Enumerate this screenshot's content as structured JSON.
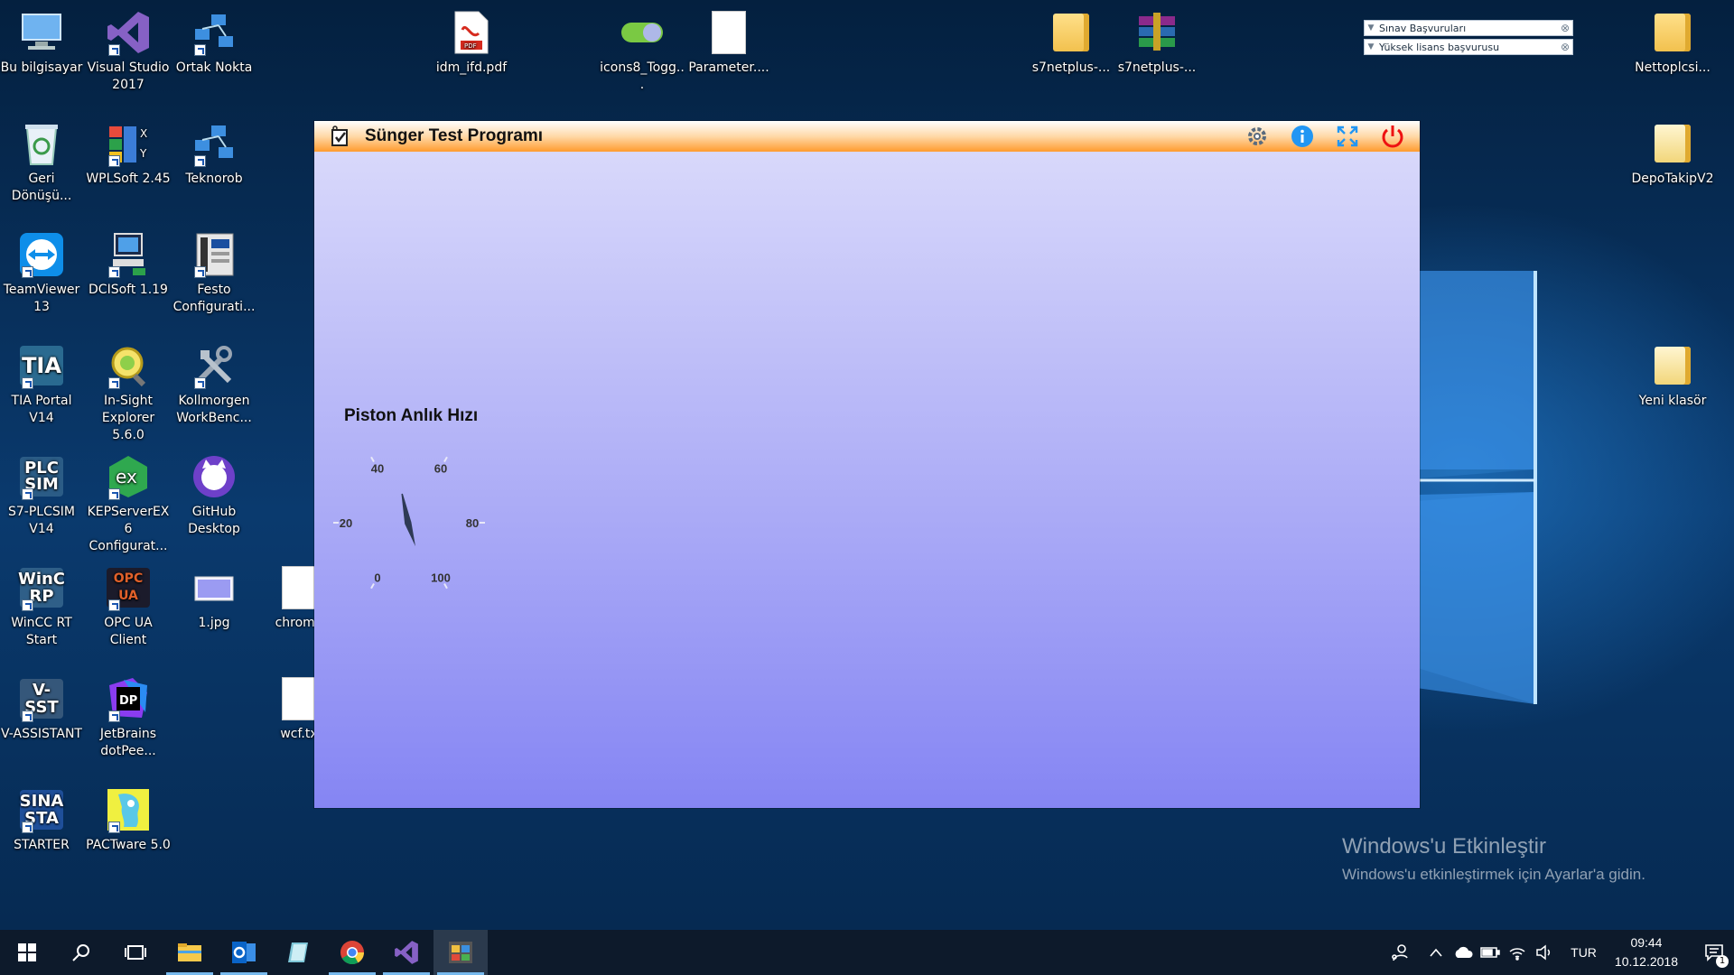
{
  "desktop": {
    "icons": {
      "bu_bilgisayar": "Bu bilgisayar",
      "visual_studio": "Visual Studio 2017",
      "ortak_nokta": "Ortak Nokta",
      "idm_pdf": "idm_ifd.pdf",
      "pdf_badge": "PDF",
      "icons8_toggle": "icons8_Togg...",
      "parameter": "Parameter....",
      "s7netplus_1": "s7netplus-...",
      "s7netplus_2": "s7netplus-...",
      "nettoplcsi": "Nettoplcsi...",
      "geri_donusum": "Geri Dönüşü...",
      "wplsoft": "WPLSoft 2.45",
      "teknorob": "Teknorob",
      "depotakip": "DepoTakipV2",
      "teamviewer": "TeamViewer 13",
      "dcisoft": "DCISoft 1.19",
      "festo": "Festo Configurati...",
      "tia_portal": "TIA Portal V14",
      "tia_text": "TIA",
      "insight": "In-Sight Explorer 5.6.0",
      "kollmorgen": "Kollmorgen WorkBenc...",
      "yeni_klasor": "Yeni klasör",
      "plcsim": "S7-PLCSIM V14",
      "plcsim_text": "PLC SIM",
      "kepserver": "KEPServerEX 6 Configurat...",
      "kepserver_text": "ex",
      "github": "GitHub Desktop",
      "wincc": "WinCC RT Start",
      "wincc_text": "WinC RP",
      "opcua": "OPC UA Client",
      "opcua_text": "OPC UA",
      "jpg": "1.jpg",
      "chrome_file": "chrome",
      "vassistant": "V-ASSISTANT",
      "vassistant_text": "V- SST",
      "jetbrains": "JetBrains dotPee...",
      "jetbrains_text": "DP",
      "wcf": "wcf.tx",
      "starter": "STARTER",
      "starter_text": "SINA STA",
      "pactware": "PACTware 5.0"
    },
    "sticky_tabs": [
      "Sınav Başvuruları",
      "Yüksek lisans başvurusu"
    ]
  },
  "app": {
    "title": "Sünger Test Programı",
    "buttons": [
      "settings",
      "info",
      "fullscreen",
      "power"
    ],
    "gauge": {
      "title": "Piston Anlık Hızı",
      "ticks": [
        "0",
        "20",
        "40",
        "60",
        "80",
        "100"
      ],
      "min": 0,
      "max": 100,
      "value": 45
    }
  },
  "watermark": {
    "line1": "Windows'u Etkinleştir",
    "line2": "Windows'u etkinleştirmek için Ayarlar'a gidin."
  },
  "taskbar": {
    "language": "TUR",
    "time": "09:44",
    "date": "10.12.2018",
    "notification_count": "1"
  },
  "colors": {
    "titlebar_accent": "#ff9b2e",
    "app_bg_top": "#dcdcfb",
    "app_bg_bottom": "#8585f3",
    "taskbar": "#0d1a2b"
  }
}
